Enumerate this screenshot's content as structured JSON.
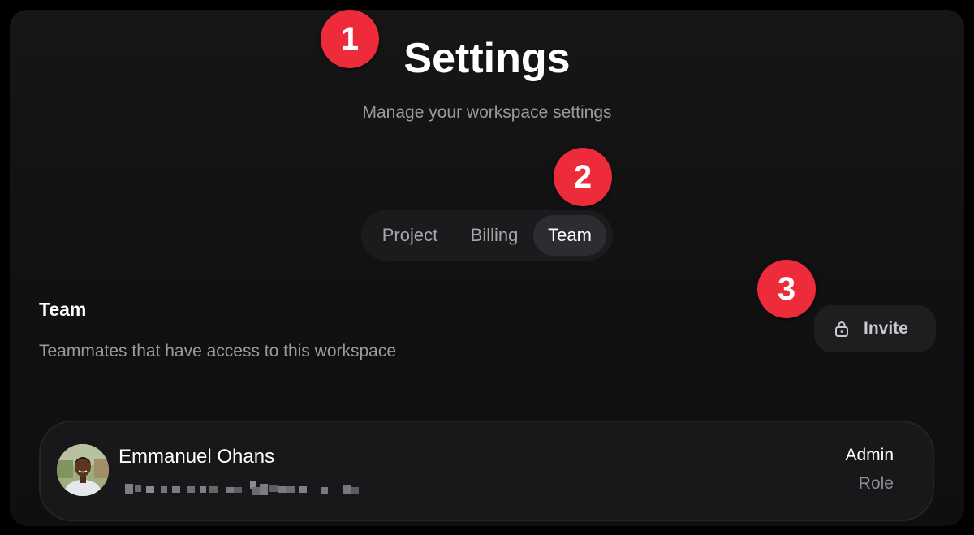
{
  "page": {
    "title": "Settings",
    "subtitle": "Manage your workspace settings"
  },
  "annotations": {
    "badge_1": "1",
    "badge_2": "2",
    "badge_3": "3",
    "badge_color": "#ed2b3b"
  },
  "tabs": {
    "items": [
      {
        "label": "Project",
        "active": false
      },
      {
        "label": "Billing",
        "active": false
      },
      {
        "label": "Team",
        "active": true
      }
    ]
  },
  "team_section": {
    "title": "Team",
    "description": "Teammates that have access to this workspace",
    "invite_button": {
      "label": "Invite",
      "icon": "lock-icon"
    }
  },
  "members": [
    {
      "name": "Emmanuel Ohans",
      "email_redacted": true,
      "role_value": "Admin",
      "role_label": "Role",
      "avatar": "avatar-photo"
    }
  ]
}
